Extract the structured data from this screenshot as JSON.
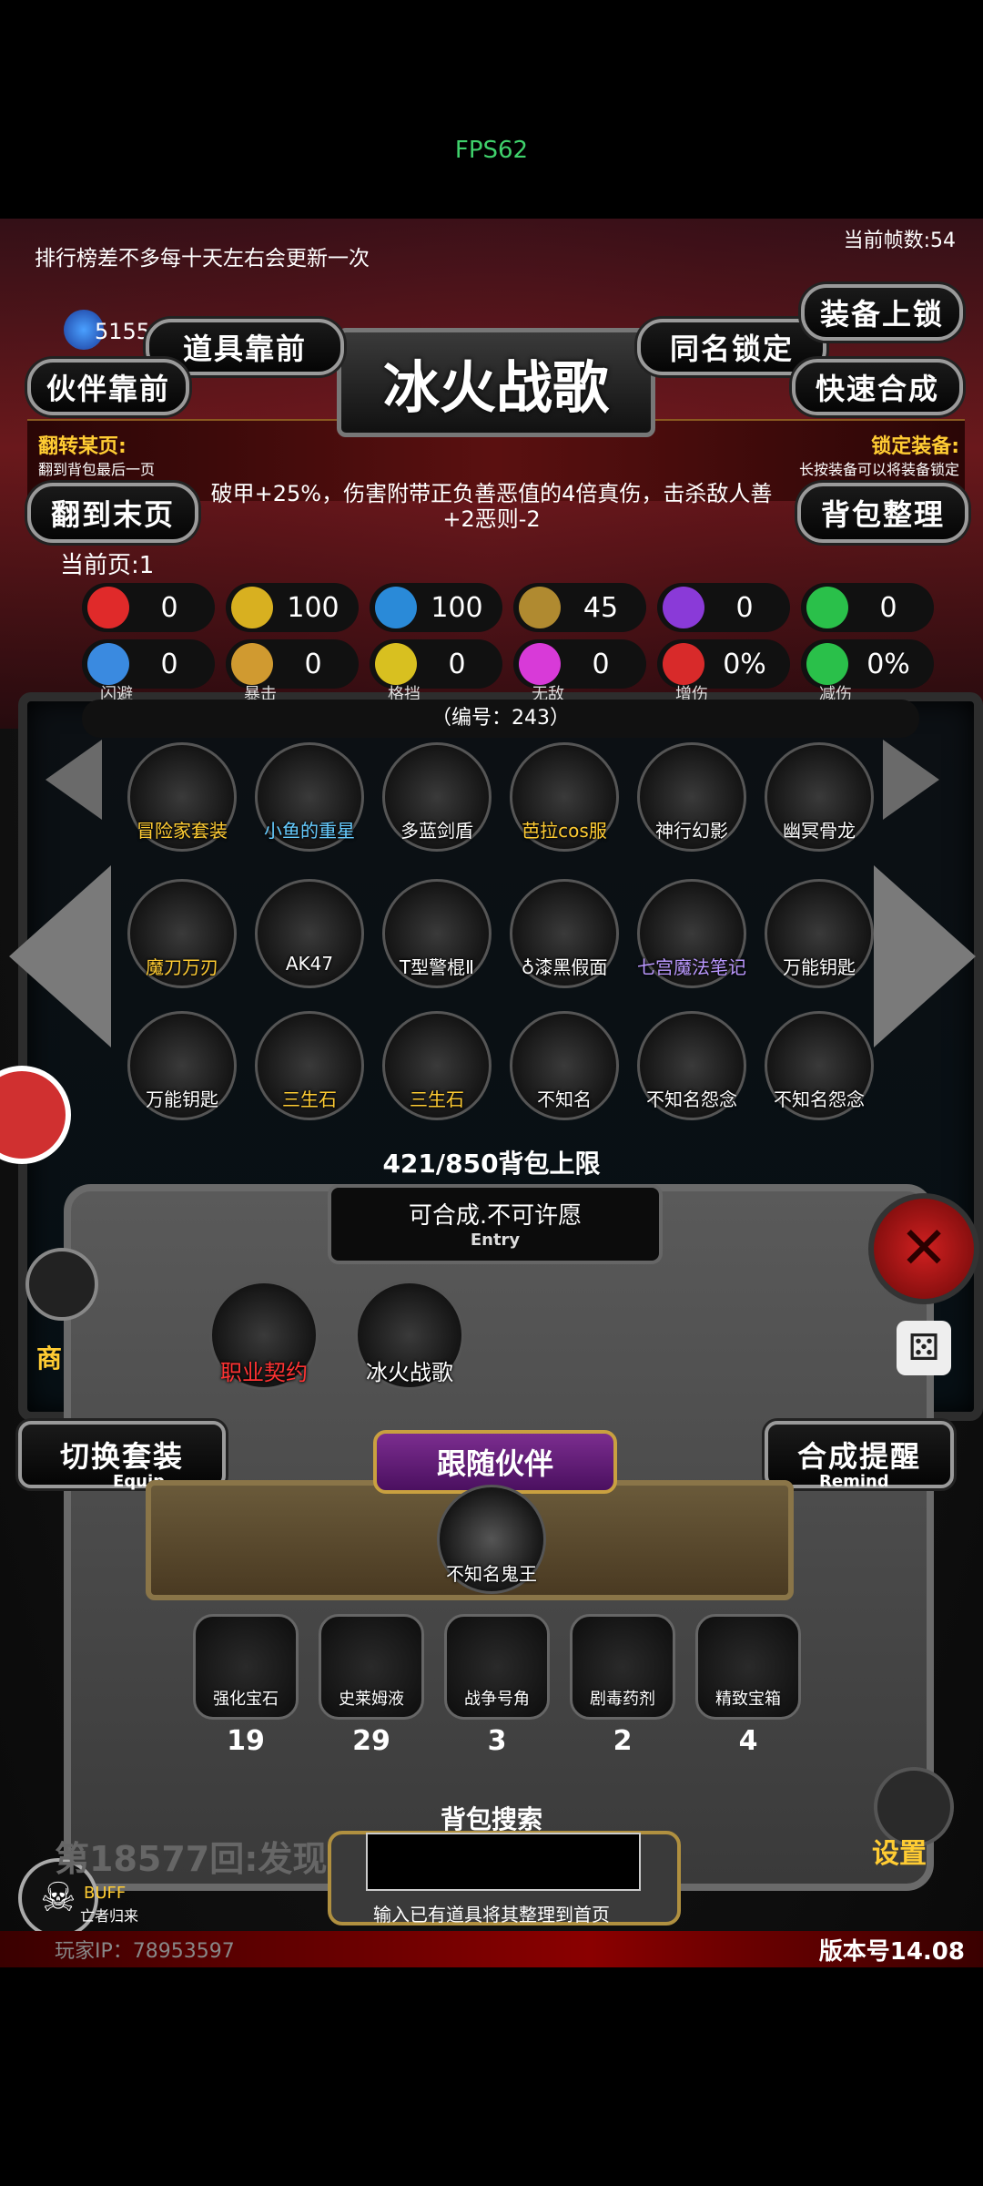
{
  "status": {
    "fps": "FPS62"
  },
  "header": {
    "notice": "排行榜差不多每十天左右会更新一次",
    "frame_count": "当前帧数:54",
    "currency": "5155",
    "title": "冰火战歌"
  },
  "buttons": {
    "items_front": "道具靠前",
    "same_name_lock": "同名锁定",
    "equip_lock": "装备上锁",
    "partner_front": "伙伴靠前",
    "quick_merge": "快速合成",
    "last_page": "翻到末页",
    "bag_sort": "背包整理"
  },
  "hints": {
    "flip_page_title": "翻转某页:",
    "flip_page_desc": "翻到背包最后一页",
    "lock_equip_title": "锁定装备:",
    "lock_equip_desc": "长按装备可以将装备锁定"
  },
  "description": {
    "line1": "破甲+25%，伤害附带正负善恶值的4倍真伤，击杀敌人善",
    "line2": "+2恶则-2"
  },
  "page": {
    "current": "当前页:1"
  },
  "stats_row1": [
    {
      "icon": "heart-icon",
      "value": "0",
      "color": "#e02a2a"
    },
    {
      "icon": "strength-icon",
      "value": "100",
      "color": "#d8b020"
    },
    {
      "icon": "helmet-icon",
      "value": "100",
      "color": "#2a8ad8"
    },
    {
      "icon": "sword-icon",
      "value": "45",
      "color": "#b08a30"
    },
    {
      "icon": "lightning-icon",
      "value": "0",
      "color": "#8a3ad8"
    },
    {
      "icon": "clover-icon",
      "value": "0",
      "color": "#2ac04a"
    }
  ],
  "stats_row2": [
    {
      "icon": "dodge-icon",
      "value": "0",
      "caption": "闪避",
      "color": "#3a8ae0"
    },
    {
      "icon": "crit-icon",
      "value": "0",
      "caption": "暴击",
      "color": "#d09a30"
    },
    {
      "icon": "shield-icon",
      "value": "0",
      "caption": "格挡",
      "color": "#d8c020"
    },
    {
      "icon": "wings-icon",
      "value": "0",
      "caption": "无敌",
      "color": "#d83ad8"
    },
    {
      "icon": "damage-up-icon",
      "value": "0%",
      "caption": "增伤",
      "color": "#d82a2a"
    },
    {
      "icon": "damage-reduce-icon",
      "value": "0%",
      "caption": "减伤",
      "color": "#2ac04a"
    }
  ],
  "item_code": "（编号：243）",
  "inventory": [
    {
      "name": "冒险家套装",
      "color": "#ffcc33"
    },
    {
      "name": "小鱼的重星",
      "color": "#66ccff"
    },
    {
      "name": "多蓝剑盾",
      "color": "#ffffff"
    },
    {
      "name": "芭拉cos服",
      "color": "#ffcc33"
    },
    {
      "name": "神行幻影",
      "color": "#ffffff"
    },
    {
      "name": "幽冥骨龙",
      "color": "#ffffff"
    },
    {
      "name": "魔刀万刃",
      "color": "#ffcc33"
    },
    {
      "name": "AK47",
      "color": "#ffffff"
    },
    {
      "name": "T型警棍Ⅱ",
      "color": "#ffffff"
    },
    {
      "name": "♁漆黑假面",
      "color": "#ffffff"
    },
    {
      "name": "七宫魔法笔记",
      "color": "#bb99ff"
    },
    {
      "name": "万能钥匙",
      "color": "#ffffff"
    },
    {
      "name": "万能钥匙",
      "color": "#ffffff"
    },
    {
      "name": "三生石",
      "color": "#ffcc33"
    },
    {
      "name": "三生石",
      "color": "#ffcc33"
    },
    {
      "name": "不知名",
      "color": "#ffffff"
    },
    {
      "name": "不知名怨念",
      "color": "#ffffff"
    },
    {
      "name": "不知名怨念",
      "color": "#ffffff"
    }
  ],
  "bag_limit": "421/850背包上限",
  "merge": {
    "status": "可合成.不可许愿",
    "sub": "Entry"
  },
  "equipped": [
    {
      "name": "职业契约",
      "color": "#ff3333"
    },
    {
      "name": "冰火战歌",
      "color": "#ffffff"
    }
  ],
  "side_buttons": {
    "switch_set": "切换套装",
    "switch_set_sub": "Equip",
    "merge_remind": "合成提醒",
    "merge_remind_sub": "Remind",
    "shop": "商",
    "settings": "设置",
    "buff": "BUFF",
    "buff_sub": "亡者归来"
  },
  "follow": {
    "label": "跟随伙伴",
    "partner": "不知名鬼王"
  },
  "materials": [
    {
      "name": "强化宝石",
      "count": "19"
    },
    {
      "name": "史莱姆液",
      "count": "29"
    },
    {
      "name": "战争号角",
      "count": "3"
    },
    {
      "name": "剧毒药剂",
      "count": "2"
    },
    {
      "name": "精致宝箱",
      "count": "4"
    }
  ],
  "search": {
    "title": "背包搜索",
    "hint": "输入已有道具将其整理到首页",
    "value": ""
  },
  "footer": {
    "round": "第18577回:发现",
    "player_ip": "玩家IP：78953597",
    "version": "版本号14.08"
  }
}
